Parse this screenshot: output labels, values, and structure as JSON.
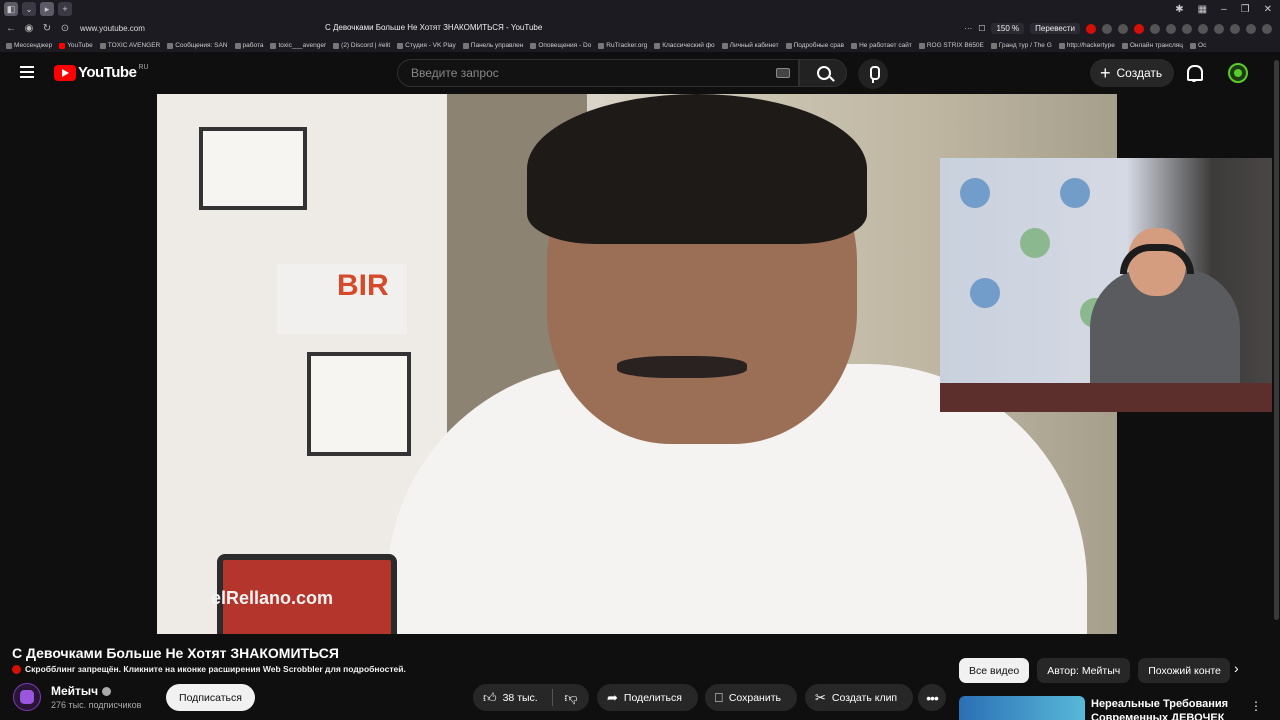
{
  "browser": {
    "url": "www.youtube.com",
    "tab_title": "С Девочками Больше Не Хотят ЗНАКОМИТЬСЯ - YouTube",
    "zoom": "150 %",
    "translate_label": "Перевести",
    "bookmarks": [
      "Мессенджер",
      "YouTube",
      "TOXIC AVENGER",
      "Сообщения: SAN",
      "работа",
      "toxic___avenger",
      "(2) Discord | #elit",
      "Студия - VK Play",
      "Панель управлен",
      "Оповещения - Do",
      "RuTracker.org",
      "Классический фо",
      "Личный кабинет",
      "Подробные срав",
      "Не работает сайт",
      "ROG STRIX B650E",
      "Гранд тур / The G",
      "http://hackertype",
      "Онлайн трансляц",
      "Ос"
    ]
  },
  "header": {
    "logo_text": "YouTube",
    "logo_country": "RU",
    "search_placeholder": "Введите запрос",
    "create_label": "Создать"
  },
  "video": {
    "watermark": "elRellano.com",
    "sign_text": "BIR"
  },
  "meta": {
    "title": "С Девочками Больше Не Хотят ЗНАКОМИТЬСЯ",
    "scrobble_notice": "Скробблинг запрещён. Кликните на иконке расширения Web Scrobbler для подробностей.",
    "channel_name": "Мейтыч",
    "subscribers": "276 тыс. подписчиков",
    "subscribe_label": "Подписаться",
    "likes": "38 тыс.",
    "share_label": "Поделиться",
    "save_label": "Сохранить",
    "clip_label": "Создать клип",
    "more_label": "•••"
  },
  "sidebar": {
    "chips": [
      "Все видео",
      "Автор: Мейтыч",
      "Похожий конте"
    ],
    "recommended": {
      "title": "Нереальные Требования Современных ДЕВОЧЕК"
    }
  },
  "colors": {
    "background": "#0f0f0f",
    "brand": "#ff0000",
    "pill": "#272727"
  }
}
